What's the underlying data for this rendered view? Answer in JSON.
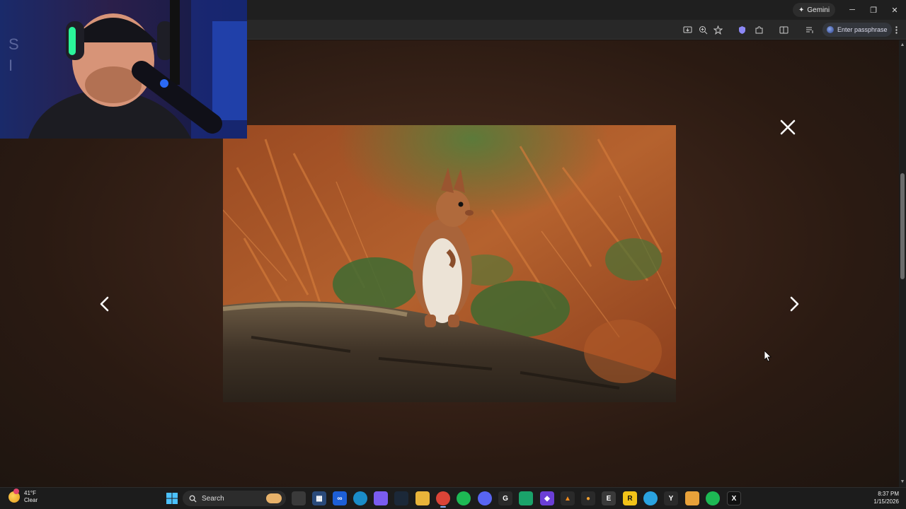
{
  "browser": {
    "gemini_label": "Gemini",
    "passphrase_label": "Enter passphrase"
  },
  "lightbox": {
    "close_icon": "close-icon",
    "prev_icon": "chevron-left-icon",
    "next_icon": "chevron-right-icon",
    "image_subject": "red-squirrel-photo"
  },
  "taskbar": {
    "weather_temp": "41°F",
    "weather_cond": "Clear",
    "search_label": "Search",
    "time": "8:37 PM",
    "date": "1/15/2026",
    "apps": [
      "windows-start",
      "task-view",
      "microsoft-store",
      "meta-app",
      "edge",
      "copilot",
      "steam",
      "file-explorer",
      "chrome",
      "spotify",
      "discord",
      "game-app",
      "app-ab",
      "purple-app",
      "vlc",
      "amazon-app",
      "epic-games",
      "rockstar",
      "telegram",
      "cursor-app",
      "folder-app",
      "spotify-2",
      "x-app"
    ]
  },
  "colors": {
    "accent": "#8ab4f8",
    "taskbar_bg": "#1c1c1c",
    "lightbox_bg": "#3a2318"
  }
}
